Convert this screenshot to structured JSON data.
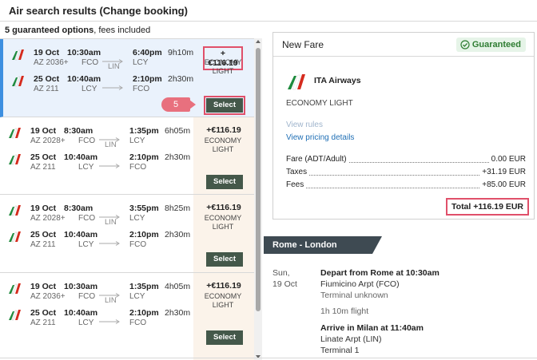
{
  "header": {
    "title": "Air search results (Change booking)"
  },
  "summary": {
    "count_bold": "5 guaranteed options",
    "rest": ", fees included"
  },
  "select_label": "Select",
  "step_badge": "5",
  "results": [
    {
      "selected": true,
      "price": "+€116.19",
      "fare": "ECONOMY LIGHT",
      "legs": [
        {
          "date": "19 Oct",
          "flight": "AZ 2036+",
          "dep_time": "10:30am",
          "dep_ap": "FCO",
          "via": "LIN",
          "arr_time": "6:40pm",
          "arr_ap": "LCY",
          "dur": "9h10m"
        },
        {
          "date": "25 Oct",
          "flight": "AZ 211",
          "dep_time": "10:40am",
          "dep_ap": "LCY",
          "via": "",
          "arr_time": "2:10pm",
          "arr_ap": "FCO",
          "dur": "2h30m"
        }
      ]
    },
    {
      "selected": false,
      "price": "+€116.19",
      "fare": "ECONOMY LIGHT",
      "legs": [
        {
          "date": "19 Oct",
          "flight": "AZ 2028+",
          "dep_time": "8:30am",
          "dep_ap": "FCO",
          "via": "LIN",
          "arr_time": "1:35pm",
          "arr_ap": "LCY",
          "dur": "6h05m"
        },
        {
          "date": "25 Oct",
          "flight": "AZ 211",
          "dep_time": "10:40am",
          "dep_ap": "LCY",
          "via": "",
          "arr_time": "2:10pm",
          "arr_ap": "FCO",
          "dur": "2h30m"
        }
      ]
    },
    {
      "selected": false,
      "price": "+€116.19",
      "fare": "ECONOMY LIGHT",
      "legs": [
        {
          "date": "19 Oct",
          "flight": "AZ 2028+",
          "dep_time": "8:30am",
          "dep_ap": "FCO",
          "via": "LIN",
          "arr_time": "3:55pm",
          "arr_ap": "LCY",
          "dur": "8h25m"
        },
        {
          "date": "25 Oct",
          "flight": "AZ 211",
          "dep_time": "10:40am",
          "dep_ap": "LCY",
          "via": "",
          "arr_time": "2:10pm",
          "arr_ap": "FCO",
          "dur": "2h30m"
        }
      ]
    },
    {
      "selected": false,
      "price": "+€116.19",
      "fare": "ECONOMY LIGHT",
      "legs": [
        {
          "date": "19 Oct",
          "flight": "AZ 2036+",
          "dep_time": "10:30am",
          "dep_ap": "FCO",
          "via": "LIN",
          "arr_time": "1:35pm",
          "arr_ap": "LCY",
          "dur": "4h05m"
        },
        {
          "date": "25 Oct",
          "flight": "AZ 211",
          "dep_time": "10:40am",
          "dep_ap": "LCY",
          "via": "",
          "arr_time": "2:10pm",
          "arr_ap": "FCO",
          "dur": "2h30m"
        }
      ]
    }
  ],
  "fare_panel": {
    "title": "New Fare",
    "badge": "Guaranteed",
    "airline": "ITA Airways",
    "fare_class": "ECONOMY LIGHT",
    "view_rules": "View rules",
    "view_pricing": "View pricing details",
    "rows": [
      {
        "label": "Fare (ADT/Adult)",
        "value": "0.00 EUR"
      },
      {
        "label": "Taxes",
        "value": "+31.19 EUR"
      },
      {
        "label": "Fees",
        "value": "+85.00 EUR"
      }
    ],
    "total": "Total +116.19 EUR"
  },
  "itinerary": {
    "route": "Rome - London",
    "day": "Sun,",
    "date": "19 Oct",
    "depart": "Depart from Rome at 10:30am",
    "depart_airport": "Fiumicino Arpt (FCO)",
    "depart_terminal": "Terminal unknown",
    "flight_time": "1h 10m flight",
    "arrive": "Arrive in Milan at 11:40am",
    "arrive_airport": "Linate Arpt (LIN)",
    "arrive_terminal": "Terminal 1"
  },
  "colors": {
    "select_button": "#44584a",
    "highlight": "#e0506a",
    "selected_bg": "#eaf2fc",
    "selected_bar": "#3d8fe0",
    "guaranteed_green": "#2e7d32",
    "link_blue": "#1f6fb5"
  }
}
